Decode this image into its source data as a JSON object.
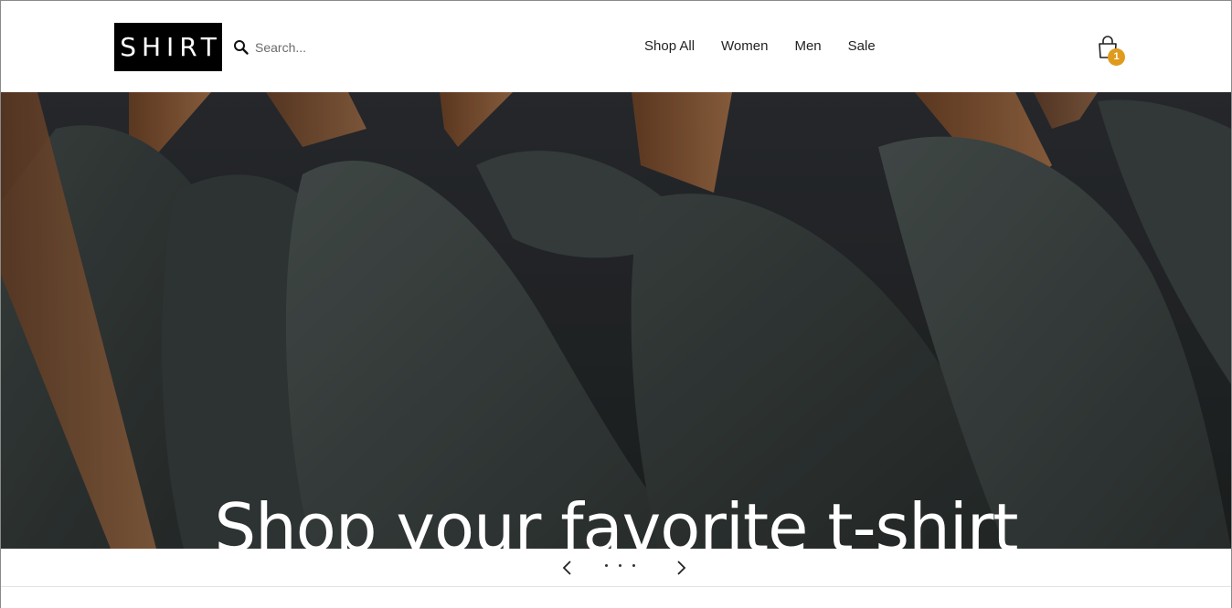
{
  "brand": {
    "logo_text": "SHIRT"
  },
  "search": {
    "placeholder": "Search..."
  },
  "nav": {
    "items": [
      {
        "label": "Shop All"
      },
      {
        "label": "Women"
      },
      {
        "label": "Men"
      },
      {
        "label": "Sale"
      }
    ]
  },
  "cart": {
    "count": "1",
    "badge_color": "#e09b1c"
  },
  "hero": {
    "headline": "Shop your favorite t-shirt",
    "image_description_icon": "hanging-tshirts-photo"
  },
  "carousel": {
    "slide_count": 3
  },
  "colors": {
    "accent": "#e09b1c",
    "logo_bg": "#000000",
    "text": "#222222"
  }
}
